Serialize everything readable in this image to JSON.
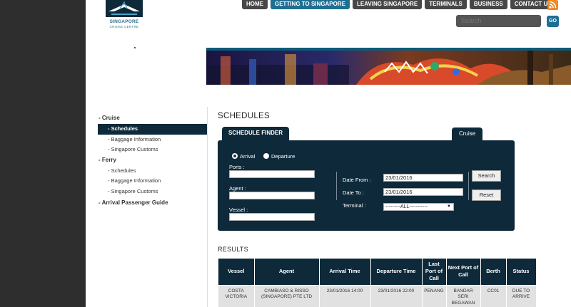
{
  "brand": {
    "name_line1": "SINGAPORE",
    "name_line2": "CRUISE CENTRE"
  },
  "topnav": {
    "items": [
      {
        "label": "HOME",
        "active": false
      },
      {
        "label": "GETTING TO SINGAPORE",
        "active": true
      },
      {
        "label": "LEAVING SINGAPORE",
        "active": false
      },
      {
        "label": "TERMINALS",
        "active": false
      },
      {
        "label": "BUSINESS",
        "active": false
      },
      {
        "label": "CONTACT US",
        "active": false
      }
    ],
    "rss_icon": "rss-icon"
  },
  "search": {
    "placeholder": "Search",
    "go_label": "GO"
  },
  "sidebar": {
    "groups": [
      {
        "label": "- Cruise",
        "items": [
          {
            "label": "- Schedules",
            "active": true
          },
          {
            "label": "- Baggage Information",
            "active": false
          },
          {
            "label": "- Singapore Customs",
            "active": false
          }
        ]
      },
      {
        "label": "- Ferry",
        "items": [
          {
            "label": "- Schedules",
            "active": false
          },
          {
            "label": "- Baggage Information",
            "active": false
          },
          {
            "label": "- Singapore Customs",
            "active": false
          }
        ]
      },
      {
        "label": "- Arrival Passenger Guide",
        "items": []
      }
    ]
  },
  "main": {
    "heading": "SCHEDULES",
    "finder_tab": "SCHEDULE FINDER",
    "cruise_tab": "Cruise",
    "finder": {
      "radio_arrival": "Arrival",
      "radio_departure": "Departure",
      "selected_radio": "arrival",
      "ports_label": "Ports :",
      "agent_label": "Agent :",
      "vessel_label": "Vessel :",
      "ports_value": "",
      "agent_value": "",
      "vessel_value": "",
      "date_from_label": "Date From :",
      "date_to_label": "Date To :",
      "terminal_label": "Terminal :",
      "date_from_value": "23/01/2016",
      "date_to_value": "23/01/2016",
      "terminal_value": "---------ALL-----------",
      "search_label": "Search",
      "reset_label": "Reset"
    },
    "results_title": "RESULTS",
    "table": {
      "headers": [
        "Vessel",
        "Agent",
        "Arrival Time",
        "Departure Time",
        "Last Port of Call",
        "Next Port of Call",
        "Berth",
        "Status"
      ],
      "rows": [
        [
          "COSTA VICTORIA",
          "CAMBIASO & RISSO (SINGAPORE) PTE LTD",
          "23/01/2016 14:00",
          "23/01/2016 22:00",
          "PENANG",
          "BANDAR SERI BEGAWAN",
          "CC01",
          "DUE TO ARRIVE"
        ]
      ]
    }
  },
  "colors": {
    "navy": "#0e2a3a",
    "nav_active": "#1f6f93",
    "nav_gray": "#474747",
    "rss_orange": "#f08a24"
  }
}
